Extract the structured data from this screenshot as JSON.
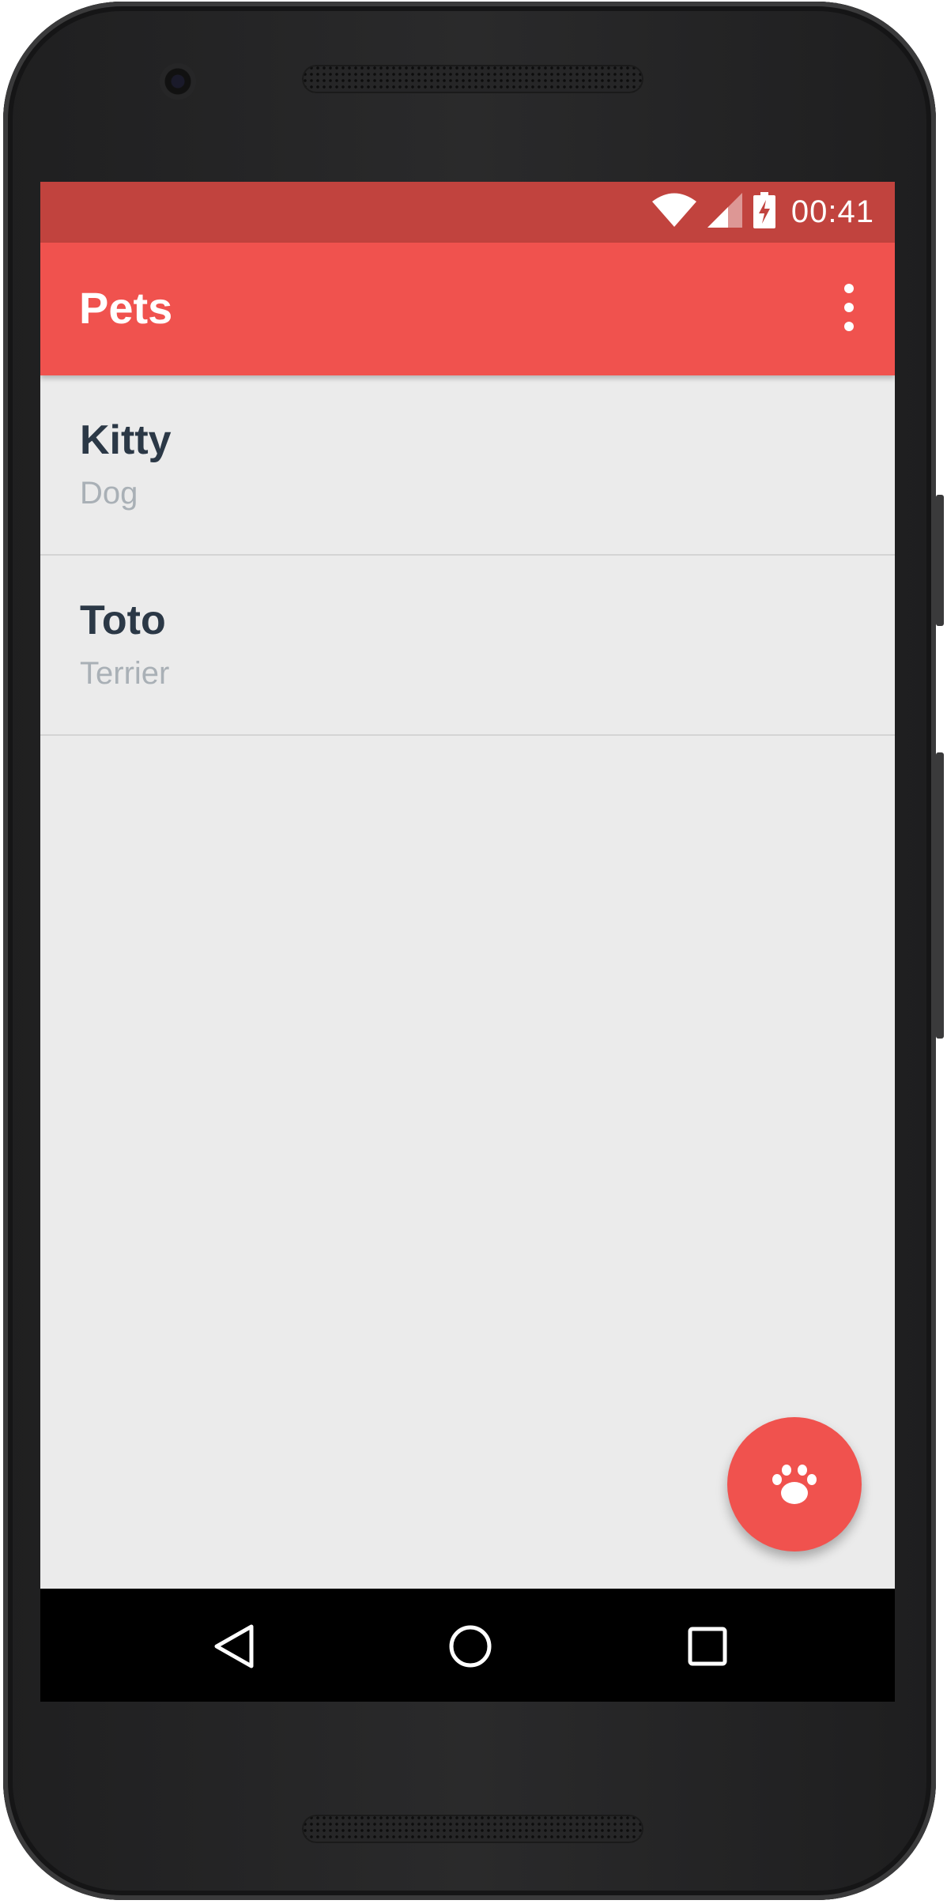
{
  "status_bar": {
    "time": "00:41",
    "icons": [
      "wifi-icon",
      "cellular-signal-icon",
      "battery-charging-icon"
    ]
  },
  "app_bar": {
    "title": "Pets",
    "overflow_icon": "more-vert-icon"
  },
  "pets": [
    {
      "name": "Kitty",
      "breed": "Dog"
    },
    {
      "name": "Toto",
      "breed": "Terrier"
    }
  ],
  "fab": {
    "icon": "paw-icon"
  },
  "nav_bar": {
    "buttons": [
      "back-icon",
      "home-icon",
      "recents-icon"
    ]
  },
  "colors": {
    "primary": "#f0524e",
    "primary_dark": "#c1433e",
    "background": "#ebebeb",
    "name_text": "#2b3846",
    "breed_text": "#a9b0b6"
  }
}
